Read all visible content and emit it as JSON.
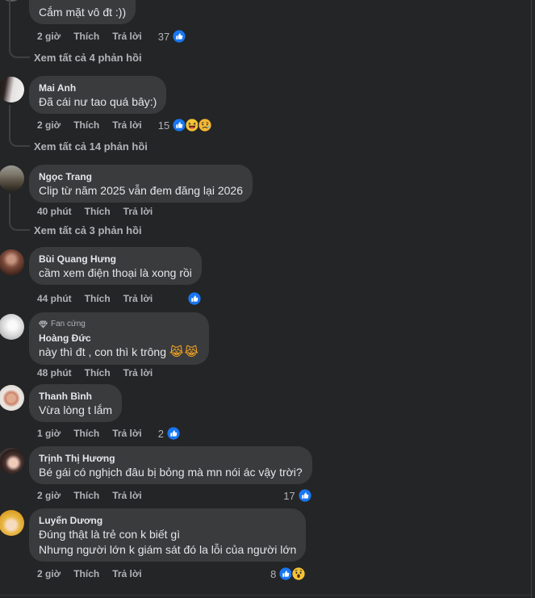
{
  "theme": {
    "background": "#242526",
    "bubble": "#3a3b3c",
    "text_primary": "#e4e6eb",
    "text_secondary": "#b0b3b8",
    "like_blue": "#1877f2",
    "thread_line": "#3e4042"
  },
  "labels": {
    "like": "Thích",
    "reply": "Trả lời"
  },
  "comments": [
    {
      "text": "Cắm mặt vô đt :))",
      "time": "2 giờ",
      "reaction_count": "37",
      "reactions": [
        "like"
      ],
      "view_replies": "Xem tất cả 4 phản hồi"
    },
    {
      "name": "Mai Anh",
      "text": "Đã cái nư tao quá bây:)",
      "time": "2 giờ",
      "reaction_count": "15",
      "reactions": [
        "like",
        "haha",
        "sad"
      ],
      "view_replies": "Xem tất cả 14 phản hồi"
    },
    {
      "name": "Ngọc Trang",
      "text": "Clip từ năm 2025 vẫn đem đăng lại 2026",
      "time": "40 phút",
      "view_replies": "Xem tất cả 3 phản hồi"
    },
    {
      "name": "Bùi Quang Hưng",
      "text": "cầm xem điện thoại là xong rồi",
      "time": "44 phút",
      "reactions": [
        "like"
      ]
    },
    {
      "badge": "Fan cứng",
      "badge_icon": "diamond-icon",
      "name": "Hoàng Đức",
      "text": "này thì đt , con thì k trông",
      "emoji": "😹😹",
      "time": "48 phút"
    },
    {
      "name": "Thanh Bình",
      "text": "Vừa lòng t lắm",
      "time": "1 giờ",
      "reaction_count": "2",
      "reactions": [
        "like"
      ]
    },
    {
      "name": "Trịnh Thị Hương",
      "text": "Bé gái có nghịch đâu bị bỏng mà mn nói ác vậy trời?",
      "time": "2 giờ",
      "reaction_count": "17",
      "reactions": [
        "like"
      ]
    },
    {
      "name": "Luyến Dương",
      "text_lines": [
        "Đúng thật là trẻ con k biết gì",
        "Nhưng người lớn k giám sát đó la lỗi của người lớn"
      ],
      "time": "2 giờ",
      "reaction_count": "8",
      "reactions": [
        "like",
        "wow"
      ]
    }
  ]
}
